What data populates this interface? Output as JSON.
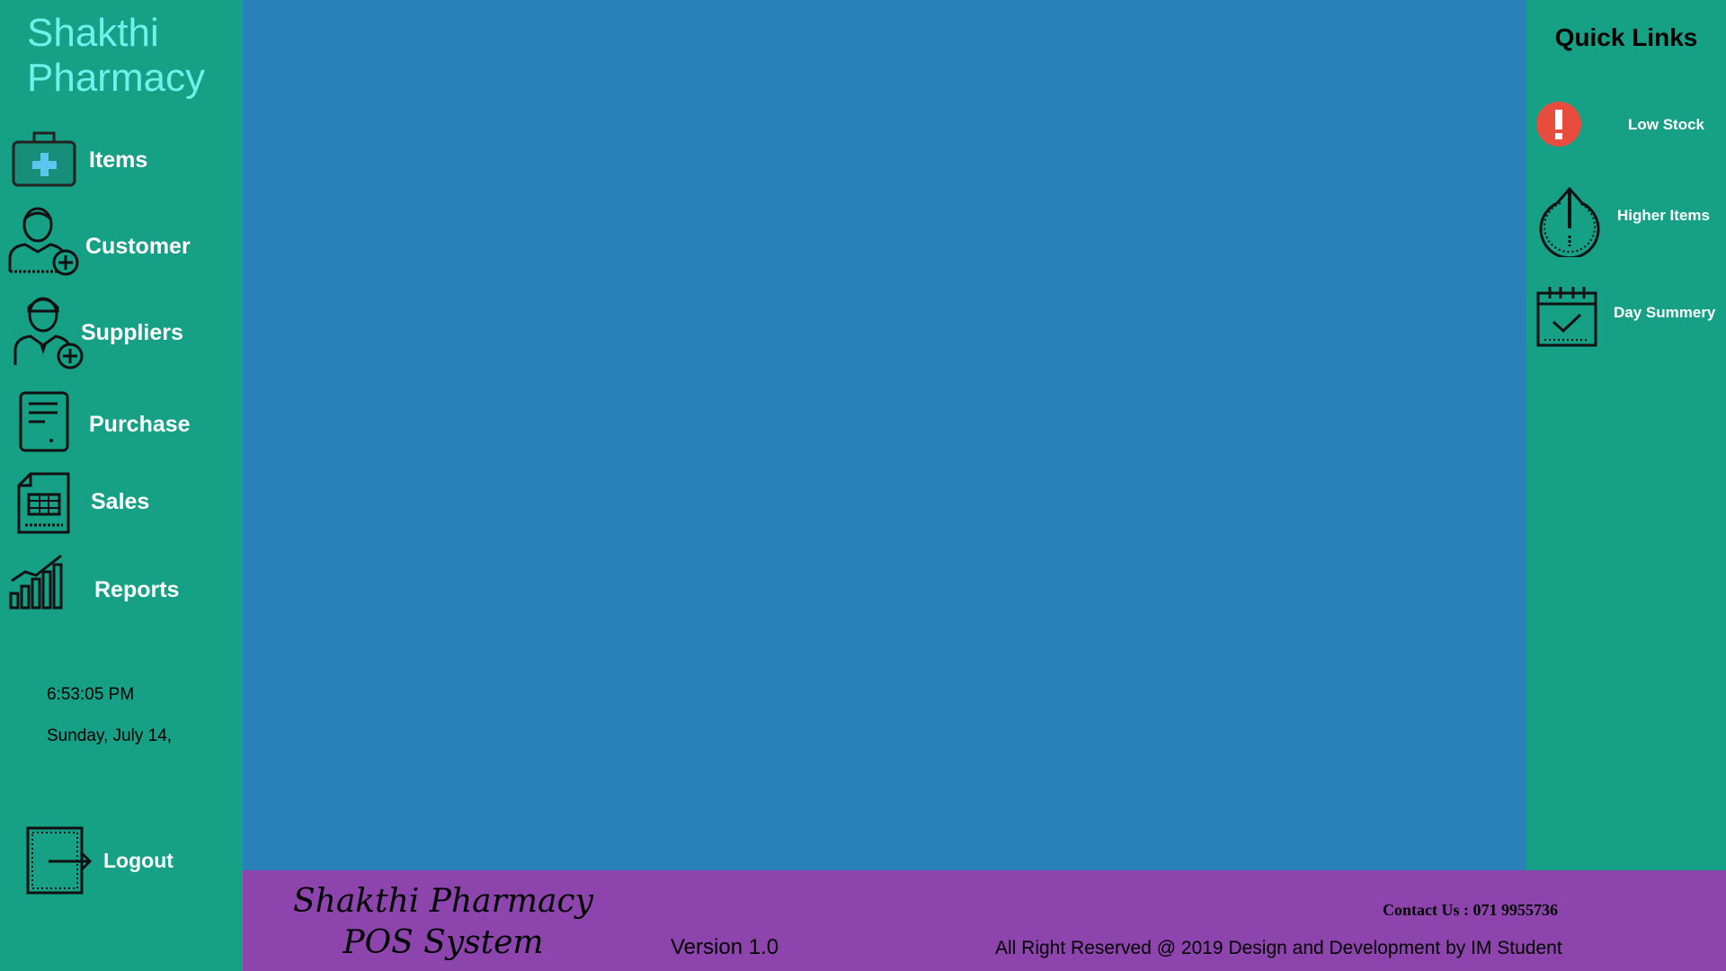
{
  "app": {
    "title_line1": "Shakthi",
    "title_line2": "Pharmacy"
  },
  "sidebar": {
    "items": [
      {
        "label": "Items",
        "icon": "medical-kit-icon"
      },
      {
        "label": "Customer",
        "icon": "add-customer-icon"
      },
      {
        "label": "Suppliers",
        "icon": "add-supplier-icon"
      },
      {
        "label": "Purchase",
        "icon": "purchase-document-icon"
      },
      {
        "label": "Sales",
        "icon": "sales-receipt-icon"
      },
      {
        "label": "Reports",
        "icon": "bar-chart-icon"
      }
    ],
    "time": "6:53:05 PM",
    "date": "Sunday, July 14,",
    "logout_label": "Logout"
  },
  "quick_links": {
    "title": "Quick Links",
    "items": [
      {
        "label": "Low Stock",
        "icon": "alert-icon"
      },
      {
        "label": "Higher Items",
        "icon": "up-arrow-circle-icon"
      },
      {
        "label": "Day Summery",
        "icon": "calendar-check-icon"
      }
    ]
  },
  "footer": {
    "brand_line1": "Shakthi Pharmacy",
    "brand_line2": "POS System",
    "version": "Version 1.0",
    "contact": "Contact Us : 071 9955736",
    "rights": "All Right Reserved @ 2019 Design and Development by IM Student"
  },
  "colors": {
    "sidebar_bg": "#16a085",
    "main_bg": "#2a80b9",
    "footer_bg": "#8e44ad",
    "title_color": "#6ff0ea",
    "alert_red": "#e74c3c"
  }
}
